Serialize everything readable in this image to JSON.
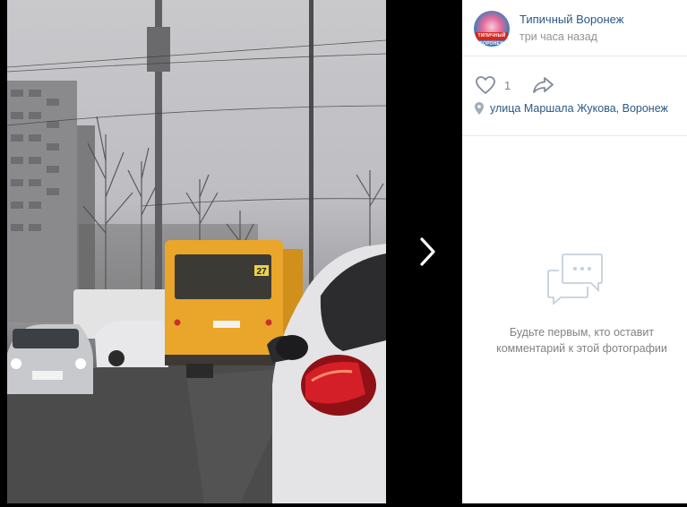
{
  "post": {
    "group_name": "Типичный Воронеж",
    "time": "три часа назад",
    "avatar_badge": "ТИПИЧНЫЙ ВОРОНЕЖ"
  },
  "actions": {
    "like_count": "1"
  },
  "location": {
    "text": "улица Маршала Жукова, Воронеж"
  },
  "comments": {
    "empty_line1": "Будьте первым, кто оставит",
    "empty_line2": "комментарий к этой фотографии"
  },
  "photo": {
    "bus_route_number": "27",
    "icon": "photo-content"
  },
  "colors": {
    "link": "#2a5885",
    "muted": "#828282",
    "divider": "#e7e8ec",
    "bus": "#e9a62a"
  }
}
